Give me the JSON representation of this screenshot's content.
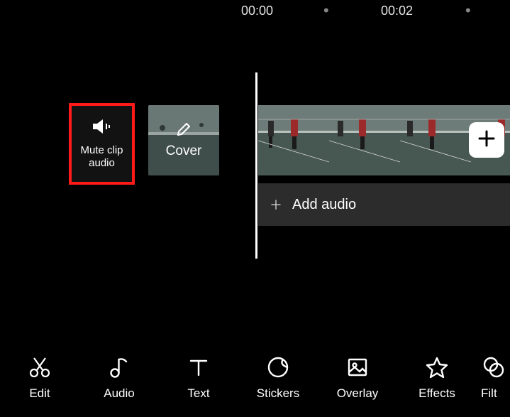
{
  "ruler": {
    "time1": "00:00",
    "time2": "00:02",
    "dot": "•"
  },
  "cards": {
    "mute": {
      "label": "Mute clip audio"
    },
    "cover": {
      "label": "Cover"
    }
  },
  "add_audio": {
    "plus": "＋",
    "label": "Add audio"
  },
  "toolbar": {
    "items": [
      {
        "id": "edit",
        "label": "Edit"
      },
      {
        "id": "audio",
        "label": "Audio"
      },
      {
        "id": "text",
        "label": "Text"
      },
      {
        "id": "stickers",
        "label": "Stickers"
      },
      {
        "id": "overlay",
        "label": "Overlay"
      },
      {
        "id": "effects",
        "label": "Effects"
      },
      {
        "id": "filters",
        "label": "Filt"
      }
    ]
  }
}
